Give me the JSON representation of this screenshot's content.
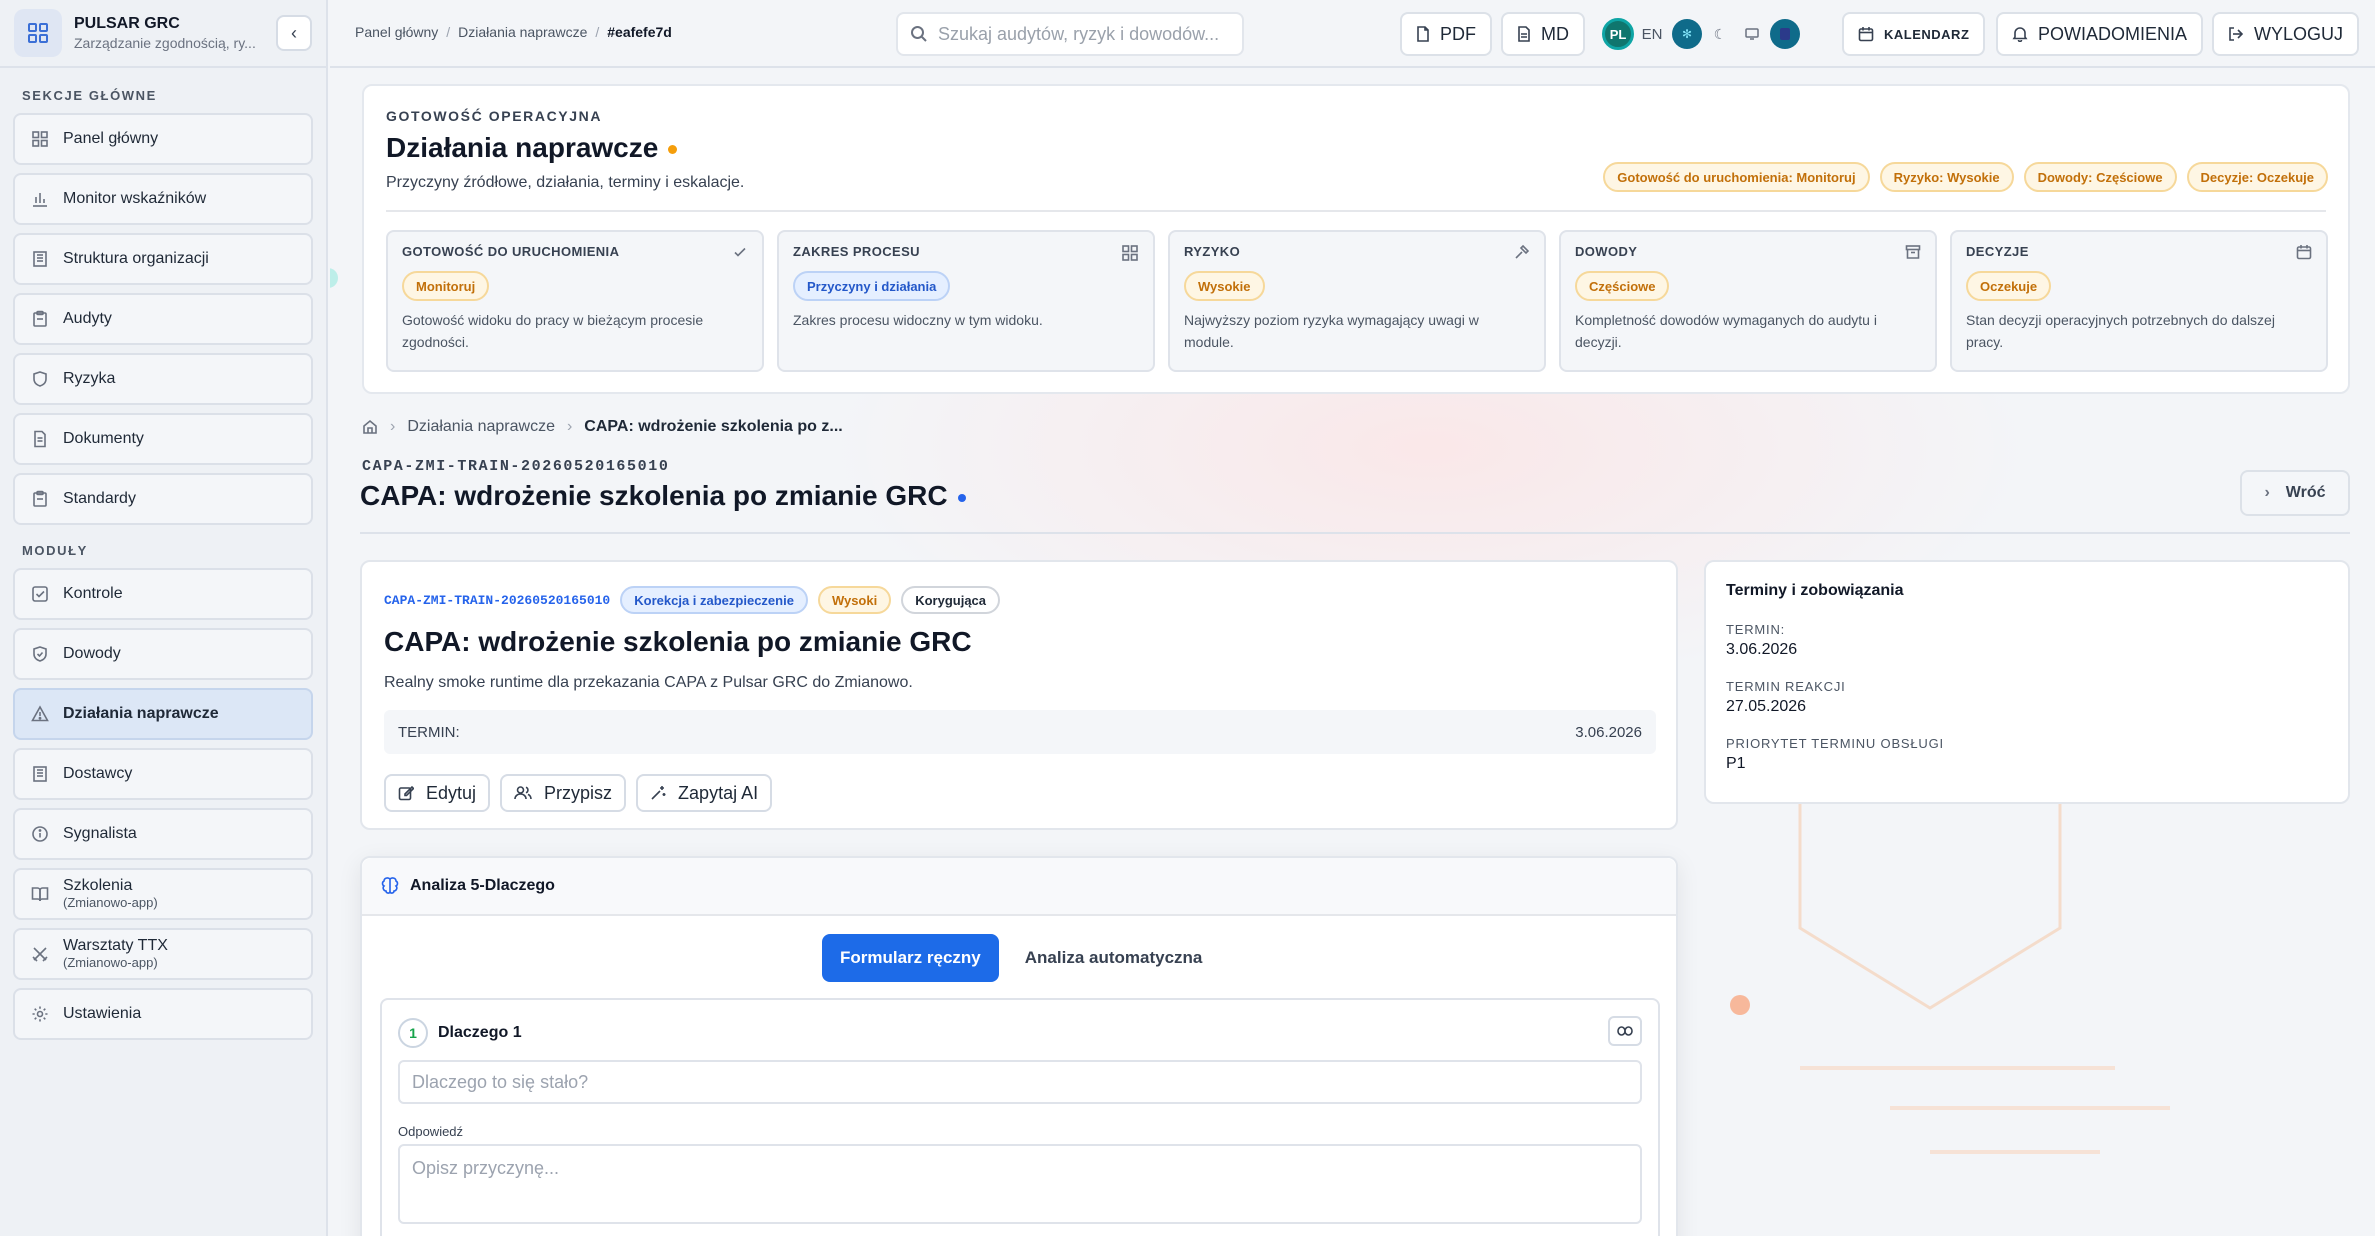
{
  "app": {
    "name": "PULSAR GRC",
    "subtitle": "Zarządzanie zgodnością, ry..."
  },
  "sidebar": {
    "main_label": "SEKCJE GŁÓWNE",
    "main_items": [
      {
        "label": "Panel główny",
        "icon": "grid-icon"
      },
      {
        "label": "Monitor wskaźników",
        "icon": "bar-chart-icon"
      },
      {
        "label": "Struktura organizacji",
        "icon": "building-icon"
      },
      {
        "label": "Audyty",
        "icon": "clipboard-icon"
      },
      {
        "label": "Ryzyka",
        "icon": "shield-icon"
      },
      {
        "label": "Dokumenty",
        "icon": "document-icon"
      },
      {
        "label": "Standardy",
        "icon": "clipboard-icon"
      }
    ],
    "modules_label": "MODUŁY",
    "module_items": [
      {
        "label": "Kontrole",
        "icon": "checkbox-icon"
      },
      {
        "label": "Dowody",
        "icon": "shield-check-icon"
      },
      {
        "label": "Działania naprawcze",
        "icon": "warning-icon",
        "active": true
      },
      {
        "label": "Dostawcy",
        "icon": "building-icon"
      },
      {
        "label": "Sygnalista",
        "icon": "info-icon"
      },
      {
        "label": "Szkolenia",
        "sub": "(Zmianowo-app)",
        "icon": "book-icon"
      },
      {
        "label": "Warsztaty TTX",
        "sub": "(Zmianowo-app)",
        "icon": "swords-icon"
      },
      {
        "label": "Ustawienia",
        "icon": "gear-icon"
      }
    ]
  },
  "topbar": {
    "breadcrumb": [
      "Panel główny",
      "Działania naprawcze",
      "#eafefe7d"
    ],
    "search_placeholder": "Szukaj audytów, ryzyk i dowodów...",
    "pdf": "PDF",
    "md": "MD",
    "lang_active": "PL",
    "lang_other": "EN",
    "calendar": "KALENDARZ",
    "notifications": "POWIADOMIENIA",
    "logout": "WYLOGUJ"
  },
  "readiness": {
    "eyebrow": "GOTOWOŚĆ OPERACYJNA",
    "title": "Działania naprawcze",
    "subtitle": "Przyczyny źródłowe, działania, terminy i eskalacje.",
    "status_tags": [
      "Gotowość do uruchomienia: Monitoruj",
      "Ryzyko: Wysokie",
      "Dowody: Częściowe",
      "Decyzje: Oczekuje"
    ],
    "tiles": [
      {
        "title": "GOTOWOŚĆ DO URUCHOMIENIA",
        "icon": "check-icon",
        "badge": "Monitoruj",
        "badge_color": "amber",
        "desc": "Gotowość widoku do pracy w bieżącym procesie zgodności."
      },
      {
        "title": "ZAKRES PROCESU",
        "icon": "grid-icon",
        "badge": "Przyczyny i działania",
        "badge_color": "blue",
        "desc": "Zakres procesu widoczny w tym widoku."
      },
      {
        "title": "RYZYKO",
        "icon": "hammer-icon",
        "badge": "Wysokie",
        "badge_color": "amber",
        "desc": "Najwyższy poziom ryzyka wymagający uwagi w module."
      },
      {
        "title": "DOWODY",
        "icon": "archive-icon",
        "badge": "Częściowe",
        "badge_color": "amber",
        "desc": "Kompletność dowodów wymaganych do audytu i decyzji."
      },
      {
        "title": "DECYZJE",
        "icon": "calendar-icon",
        "badge": "Oczekuje",
        "badge_color": "amber",
        "desc": "Stan decyzji operacyjnych potrzebnych do dalszej pracy."
      }
    ]
  },
  "detail": {
    "breadcrumb_parent": "Działania naprawcze",
    "breadcrumb_current": "CAPA: wdrożenie szkolenia po z...",
    "code": "CAPA-ZMI-TRAIN-20260520165010",
    "title": "CAPA: wdrożenie szkolenia po zmianie GRC",
    "back": "Wróć"
  },
  "record": {
    "code": "CAPA-ZMI-TRAIN-20260520165010",
    "tags": [
      "Korekcja i zabezpieczenie",
      "Wysoki",
      "Korygująca"
    ],
    "title": "CAPA: wdrożenie szkolenia po zmianie GRC",
    "description": "Realny smoke runtime dla przekazania CAPA z Pulsar GRC do Zmianowo.",
    "term_label": "TERMIN:",
    "term_value": "3.06.2026",
    "actions": {
      "edit": "Edytuj",
      "assign": "Przypisz",
      "ask_ai": "Zapytaj AI"
    }
  },
  "terms": {
    "title": "Terminy i zobowiązania",
    "items": [
      {
        "label": "TERMIN:",
        "value": "3.06.2026"
      },
      {
        "label": "TERMIN REAKCJI",
        "value": "27.05.2026"
      },
      {
        "label": "PRIORYTET TERMINU OBSŁUGI",
        "value": "P1"
      }
    ]
  },
  "why": {
    "title": "Analiza 5-Dlaczego",
    "tab_manual": "Formularz ręczny",
    "tab_auto": "Analiza automatyczna",
    "step_number": "1",
    "step_title": "Dlaczego 1",
    "question_placeholder": "Dlaczego to się stało?",
    "answer_label": "Odpowiedź",
    "answer_placeholder": "Opisz przyczynę..."
  },
  "colors": {
    "accent": "#1d6be8",
    "amber": "#c2700a",
    "active_nav": "#dce7f6"
  }
}
